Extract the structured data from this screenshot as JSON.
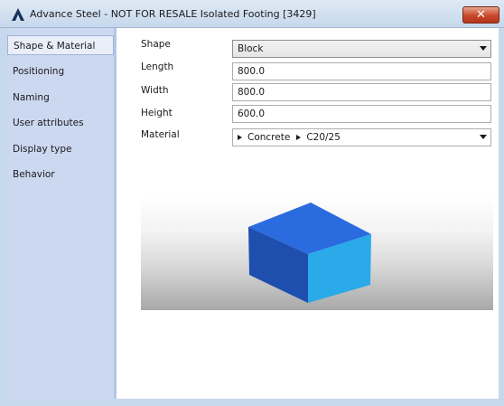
{
  "window": {
    "title": "Advance Steel - NOT FOR RESALE  Isolated Footing [3429]",
    "close_label": "✕"
  },
  "sidebar": {
    "items": [
      {
        "label": "Shape & Material",
        "active": true
      },
      {
        "label": "Positioning"
      },
      {
        "label": "Naming"
      },
      {
        "label": "User attributes"
      },
      {
        "label": "Display type"
      },
      {
        "label": "Behavior"
      }
    ]
  },
  "form": {
    "shape": {
      "label": "Shape",
      "value": "Block"
    },
    "length": {
      "label": "Length",
      "value": "800.0"
    },
    "width": {
      "label": "Width",
      "value": "800.0"
    },
    "height": {
      "label": "Height",
      "value": "600.0"
    },
    "material": {
      "label": "Material",
      "category": "Concrete",
      "grade": "C20/25"
    }
  },
  "colors": {
    "box_top": "#2a6be0",
    "box_left": "#1f4fae",
    "box_right": "#2aaae8"
  }
}
